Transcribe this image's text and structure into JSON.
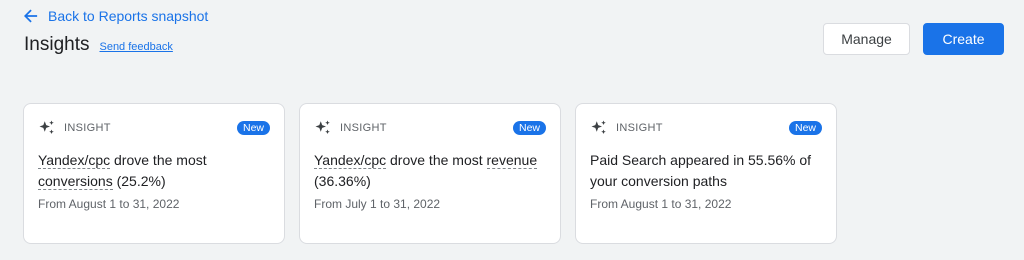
{
  "header": {
    "back_label": "Back to Reports snapshot",
    "title": "Insights",
    "feedback_label": "Send feedback",
    "manage_label": "Manage",
    "create_label": "Create"
  },
  "cards": [
    {
      "label": "INSIGHT",
      "badge": "New",
      "parts": [
        "Yandex/cpc",
        " drove the most ",
        "conversions",
        " (25.2%)"
      ],
      "date": "From August 1 to 31, 2022"
    },
    {
      "label": "INSIGHT",
      "badge": "New",
      "parts": [
        "Yandex/cpc",
        " drove the most ",
        "revenue",
        " (36.36%)"
      ],
      "date": "From July 1 to 31, 2022"
    },
    {
      "label": "INSIGHT",
      "badge": "New",
      "text": "Paid Search appeared in 55.56% of your conversion paths",
      "date": "From August 1 to 31, 2022"
    }
  ],
  "colors": {
    "accent": "#1a73e8",
    "background": "#f1f3f4",
    "card": "#ffffff",
    "border": "#dadce0"
  },
  "icons": [
    "back-arrow-icon",
    "sparkle-icon"
  ]
}
